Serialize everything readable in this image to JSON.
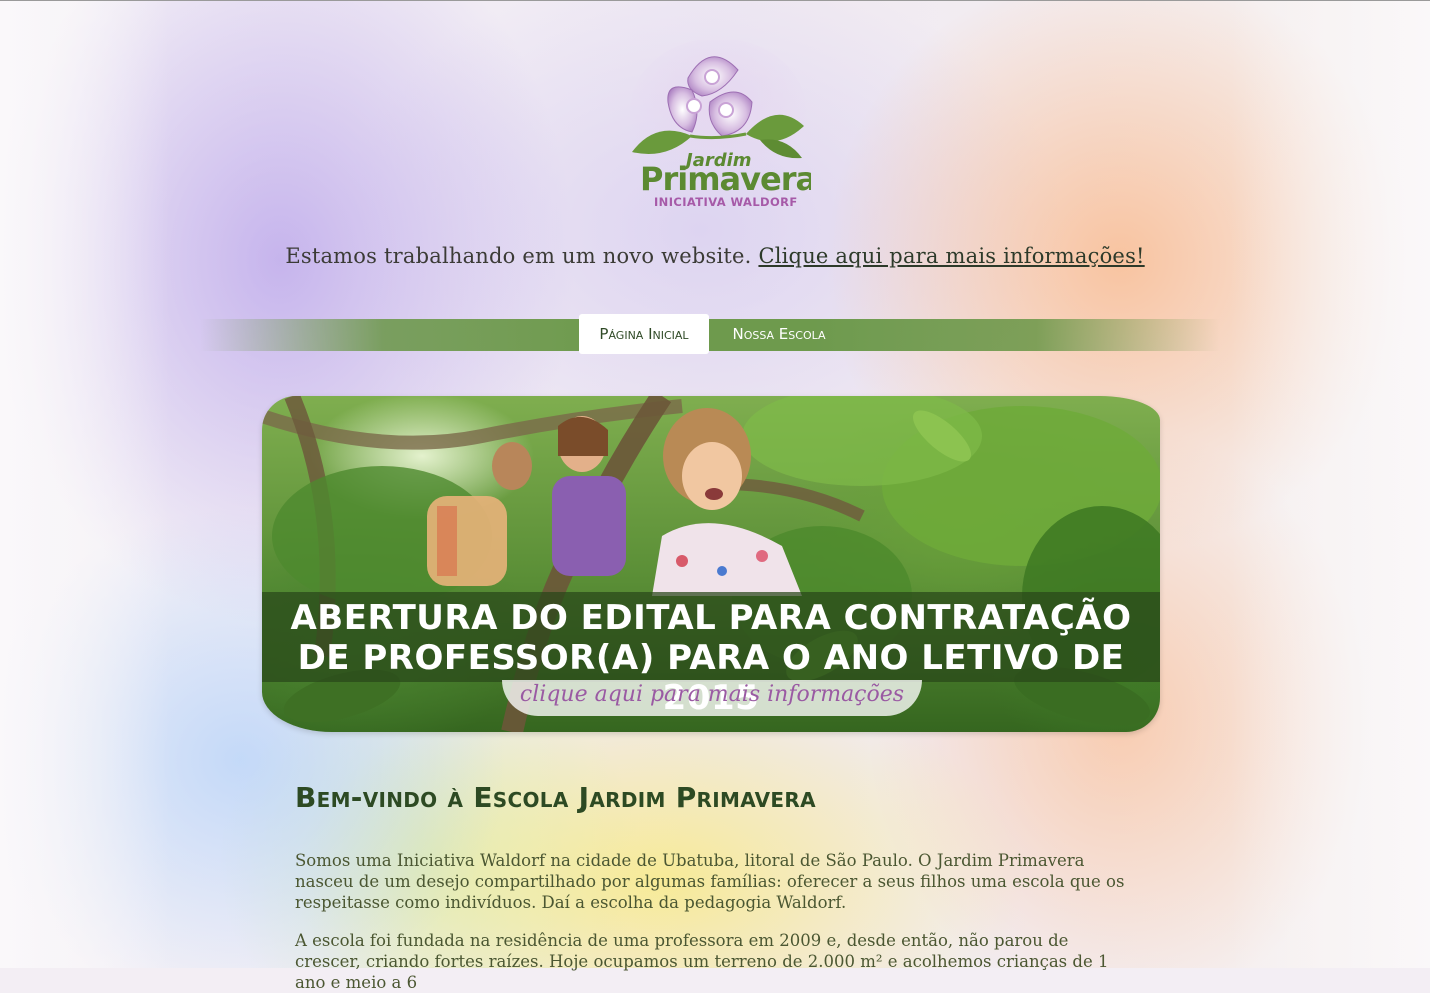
{
  "logo": {
    "line1": "Jardim",
    "line2": "Primavera",
    "tagline": "INICIATIVA WALDORF",
    "colors": {
      "petal": "#c9a3d6",
      "leaf": "#6a9a3c",
      "tagline": "#a65aa8"
    }
  },
  "notice": {
    "text": "Estamos trabalhando em um novo website.",
    "link": "Clique aqui para mais informações!"
  },
  "nav": {
    "items": [
      {
        "label": "Página Inicial",
        "active": true
      },
      {
        "label": "Nossa Escola",
        "active": false
      }
    ]
  },
  "banner": {
    "title_line1": "ABERTURA DO EDITAL PARA CONTRATAÇÃO",
    "title_line2": "DE PROFESSOR(A) PARA O ANO LETIVO DE 2015",
    "cta": "clique aqui para mais informações"
  },
  "content": {
    "heading": "Bem-vindo à Escola Jardim Primavera",
    "paragraph1": "Somos uma Iniciativa Waldorf na cidade de Ubatuba, litoral de São Paulo. O Jardim Primavera nasceu de um desejo compartilhado por algumas famílias: oferecer a seus filhos uma escola que os respeitasse como indivíduos. Daí a escolha da pedagogia Waldorf.",
    "paragraph2": "A escola foi fundada na residência de uma professora em 2009 e, desde então, não parou de crescer, criando fortes raízes. Hoje ocupamos um terreno de 2.000 m² e acolhemos crianças de 1 ano e meio a 6"
  },
  "colors": {
    "nav_green": "#6e9a4d",
    "heading_green": "#2d4a23",
    "cta_purple": "#9a5aa3"
  }
}
